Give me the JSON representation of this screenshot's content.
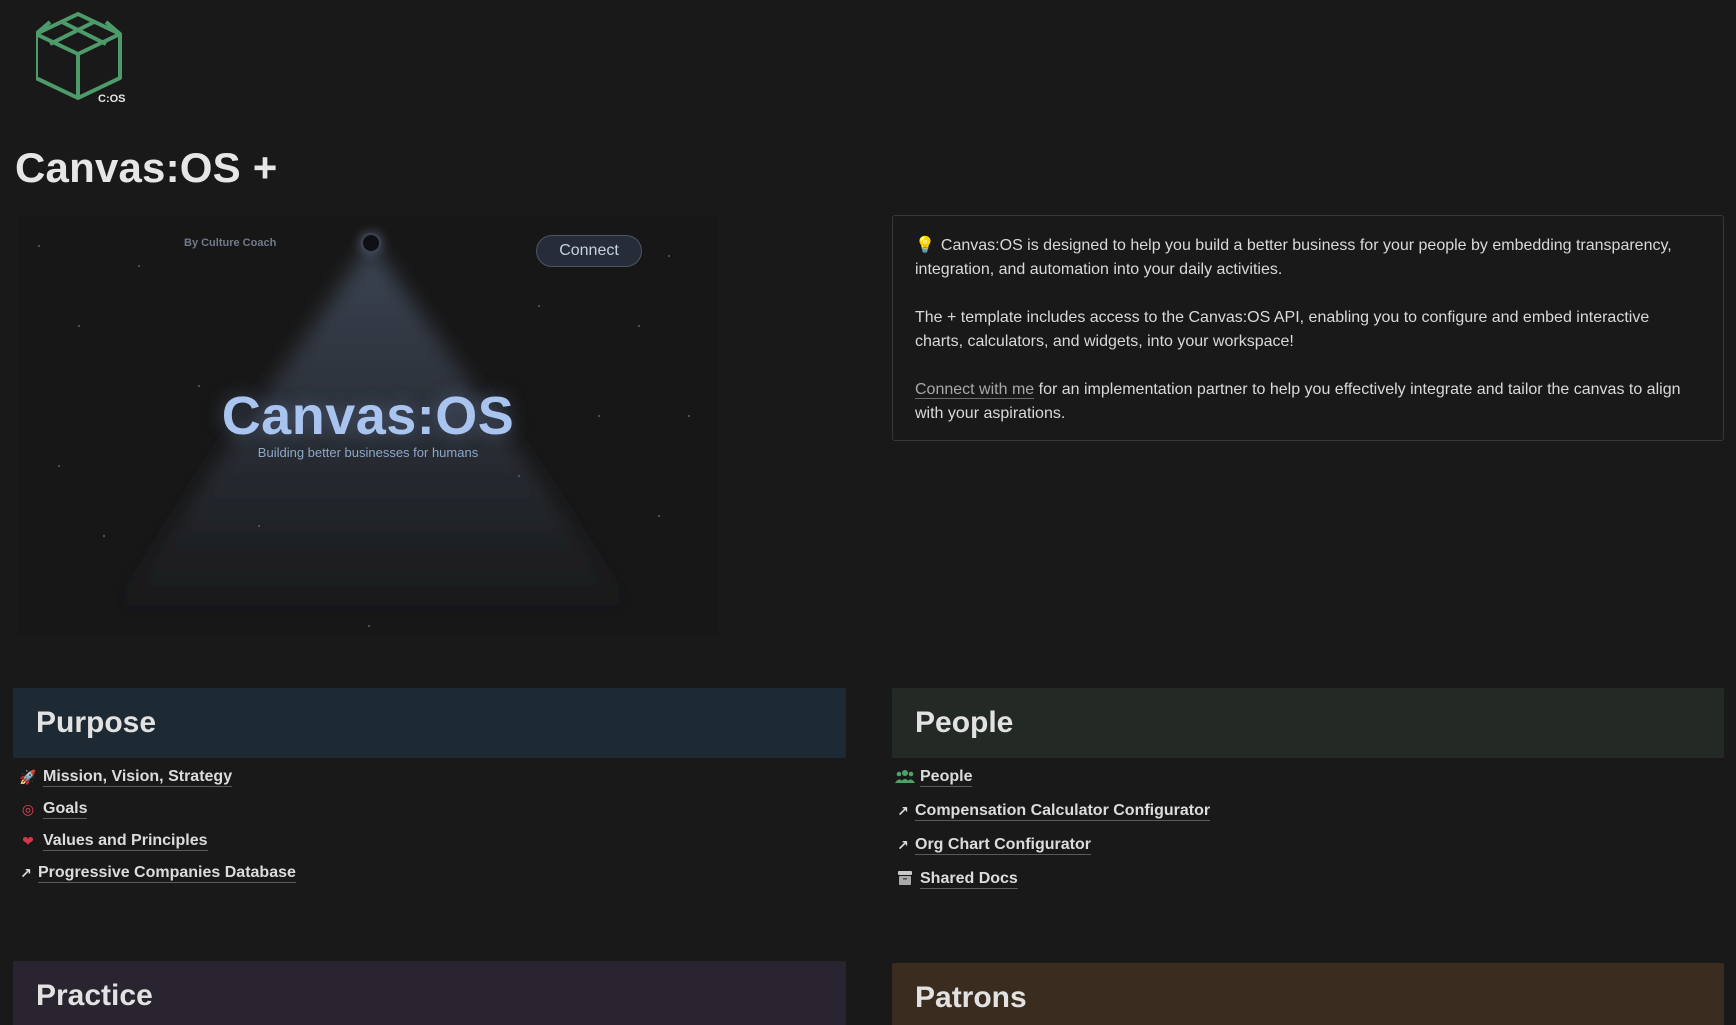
{
  "logo": {
    "badge": "C:OS"
  },
  "page": {
    "title": "Canvas:OS +"
  },
  "hero": {
    "byline": "By Culture Coach",
    "connect_label": "Connect",
    "brand": "Canvas:OS",
    "tagline": "Building better businesses for humans"
  },
  "callout": {
    "icon": "lightbulb-icon",
    "paragraph1": "Canvas:OS is designed to help you build a better business for your people by embedding transparency, integration, and automation into your daily activities.",
    "paragraph2": "The + template includes access to the Canvas:OS API, enabling you to configure and embed interactive charts, calculators, and widgets, into your workspace!",
    "link_text": "Connect with me",
    "paragraph3_rest": " for an implementation partner to help you effectively integrate and tailor the canvas to align with your aspirations."
  },
  "sections": {
    "purpose": {
      "title": "Purpose",
      "items": [
        {
          "label": "Mission, Vision, Strategy",
          "icon": "rocket-icon"
        },
        {
          "label": "Goals",
          "icon": "target-icon"
        },
        {
          "label": "Values and Principles",
          "icon": "heart-icon"
        },
        {
          "label": "Progressive Companies Database",
          "icon": "link-arrow-icon"
        }
      ]
    },
    "people": {
      "title": "People",
      "items": [
        {
          "label": "People",
          "icon": "people-group-icon"
        },
        {
          "label": "Compensation Calculator Configurator",
          "icon": "link-arrow-icon"
        },
        {
          "label": "Org Chart Configurator",
          "icon": "link-arrow-icon"
        },
        {
          "label": "Shared Docs",
          "icon": "archive-icon"
        }
      ]
    },
    "practice": {
      "title": "Practice"
    },
    "patrons": {
      "title": "Patrons"
    }
  },
  "colors": {
    "background": "#191919",
    "logo_green": "#4d9b6a",
    "brand_blue": "#a9c4ef"
  }
}
